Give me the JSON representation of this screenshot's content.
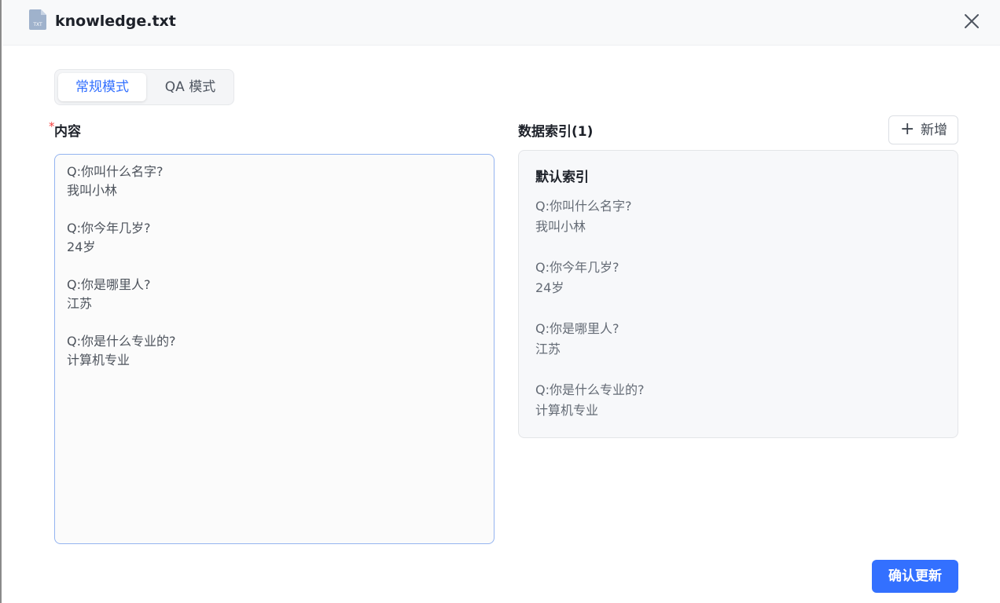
{
  "header": {
    "file_name": "knowledge.txt",
    "file_icon": "txt-file-icon",
    "file_icon_text": "TXT",
    "close_icon": "close-icon"
  },
  "mode_switch": {
    "tabs": [
      {
        "label": "常规模式",
        "active": true
      },
      {
        "label": "QA 模式",
        "active": false
      }
    ]
  },
  "content": {
    "label": "内容",
    "required_mark": "*",
    "value": "Q:你叫什么名字?\n我叫小林\n\nQ:你今年几岁?\n24岁\n\nQ:你是哪里人?\n江苏\n\nQ:你是什么专业的?\n计算机专业"
  },
  "index": {
    "label": "数据索引(1)",
    "add_button": {
      "icon": "plus-icon",
      "label": "新增"
    },
    "cards": [
      {
        "title": "默认索引",
        "text": "Q:你叫什么名字?\n我叫小林\n\nQ:你今年几岁?\n24岁\n\nQ:你是哪里人?\n江苏\n\nQ:你是什么专业的?\n计算机专业"
      }
    ]
  },
  "footer": {
    "confirm_label": "确认更新"
  },
  "colors": {
    "accent": "#3370ff",
    "required": "#f53f3f"
  }
}
